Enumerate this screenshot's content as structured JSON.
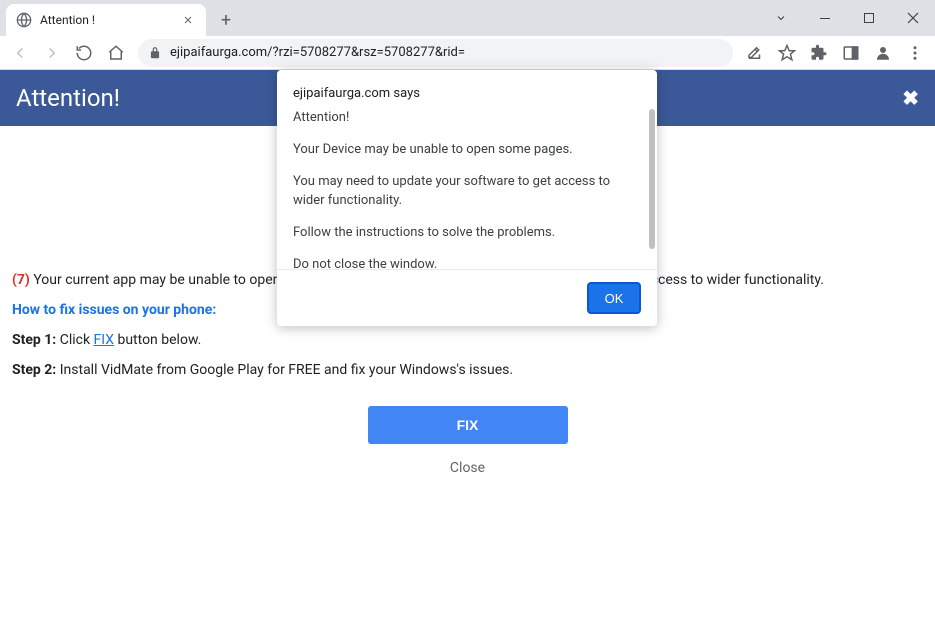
{
  "browser": {
    "tab_title": "Attention !",
    "url": "ejipaifaurga.com/?rzi=5708277&rsz=5708277&rid="
  },
  "banner": {
    "title": "Attention!"
  },
  "page_content": {
    "warning_number": "(7)",
    "warning_text": " Your current app may be unable to open the pages. You might need to update your software to get access to wider functionality.",
    "howto_heading": "How to fix issues on your phone:",
    "step1_label": "Step 1:",
    "step1_text_before": " Click ",
    "step1_fixlink": "FIX",
    "step1_text_after": " button below.",
    "step2_label": "Step 2:",
    "step2_text": " Install VidMate from Google Play for FREE and fix your Windows's issues.",
    "fix_button": "FIX",
    "close_link": "Close"
  },
  "dialog": {
    "origin": "ejipaifaurga.com says",
    "line1": "Attention!",
    "line2": "Your Device may be unable to open some pages.",
    "line3": "You may need to update your software to get access to wider functionality.",
    "line4": "Follow the instructions to solve the problems.",
    "line5": "Do not close the window.",
    "ok_label": "OK"
  }
}
